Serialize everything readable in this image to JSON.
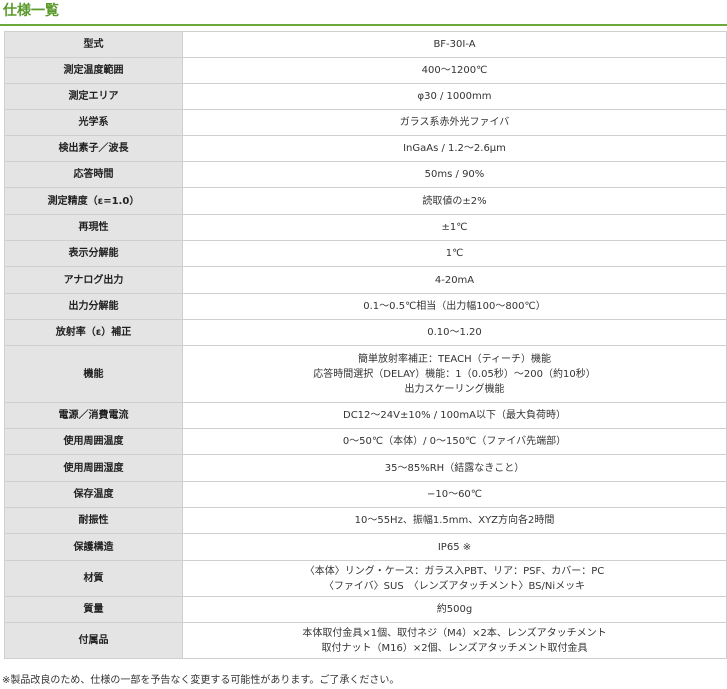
{
  "title": "仕様一覧",
  "rows": [
    {
      "label": "型式",
      "values": [
        "BF-30I-A"
      ]
    },
    {
      "label": "測定温度範囲",
      "values": [
        "400～1200℃"
      ]
    },
    {
      "label": "測定エリア",
      "values": [
        "φ30 / 1000mm"
      ]
    },
    {
      "label": "光学系",
      "values": [
        "ガラス系赤外光ファイバ"
      ]
    },
    {
      "label": "検出素子／波長",
      "values": [
        "InGaAs / 1.2～2.6μm"
      ]
    },
    {
      "label": "応答時間",
      "values": [
        "50ms / 90%"
      ]
    },
    {
      "label": "測定精度（ε=1.0）",
      "values": [
        "読取値の±2%"
      ]
    },
    {
      "label": "再現性",
      "values": [
        "±1℃"
      ]
    },
    {
      "label": "表示分解能",
      "values": [
        "1℃"
      ]
    },
    {
      "label": "アナログ出力",
      "values": [
        "4-20mA"
      ]
    },
    {
      "label": "出力分解能",
      "values": [
        "0.1～0.5℃相当（出力幅100～800℃）"
      ]
    },
    {
      "label": "放射率（ε）補正",
      "values": [
        "0.10～1.20"
      ]
    },
    {
      "label": "機能",
      "values": [
        "簡単放射率補正：TEACH（ティーチ）機能",
        "応答時間選択（DELAY）機能：1（0.05秒）～200（約10秒）",
        "出力スケーリング機能"
      ]
    },
    {
      "label": "電源／消費電流",
      "values": [
        "DC12～24V±10% / 100mA以下（最大負荷時）"
      ]
    },
    {
      "label": "使用周囲温度",
      "values": [
        "0～50℃（本体）/ 0～150℃（ファイバ先端部）"
      ]
    },
    {
      "label": "使用周囲湿度",
      "values": [
        "35～85%RH（結露なきこと）"
      ]
    },
    {
      "label": "保存温度",
      "values": [
        "−10～60℃"
      ]
    },
    {
      "label": "耐振性",
      "values": [
        "10～55Hz、振幅1.5mm、XYZ方向各2時間"
      ]
    },
    {
      "label": "保護構造",
      "values": [
        "IP65 ※"
      ]
    },
    {
      "label": "材質",
      "values": [
        "〈本体〉リング・ケース：ガラス入PBT、リア：PSF、カバー：PC",
        "〈ファイバ〉SUS　〈レンズアタッチメント〉BS/Niメッキ"
      ]
    },
    {
      "label": "質量",
      "values": [
        "約500g"
      ]
    },
    {
      "label": "付属品",
      "values": [
        "本体取付金具×1個、取付ネジ（M4）×2本、レンズアタッチメント",
        "取付ナット（M16）×2個、レンズアタッチメント取付金具"
      ]
    }
  ],
  "footnote": "※製品改良のため、仕様の一部を予告なく変更する可能性があります。ご了承ください。"
}
